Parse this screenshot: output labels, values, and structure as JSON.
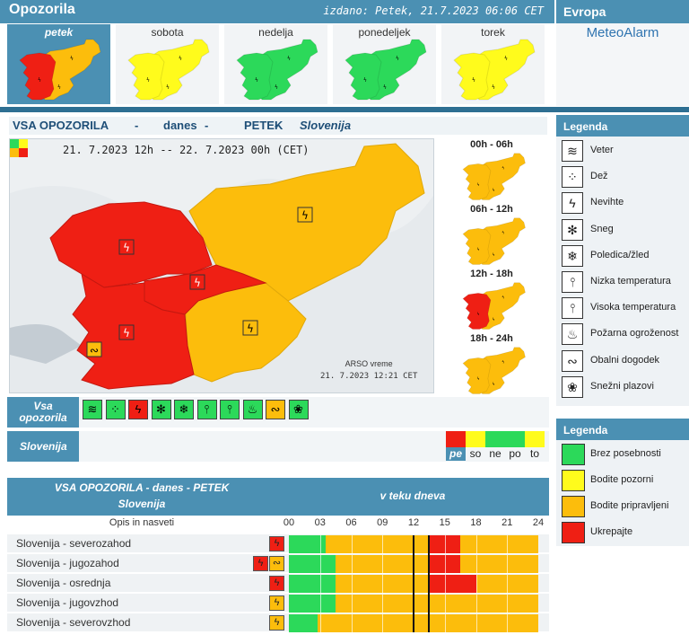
{
  "header": {
    "title": "Opozorila",
    "issued": "izdano: Petek, 21.7.2023 06:06 CET",
    "europe_title": "Evropa",
    "meteoalarm_link": "MeteoAlarm"
  },
  "days": [
    {
      "label": "petek",
      "active": true,
      "color": "#fcbd0c",
      "secondary_color": "#ef1f14"
    },
    {
      "label": "sobota",
      "active": false,
      "color": "#fffb1c"
    },
    {
      "label": "nedelja",
      "active": false,
      "color": "#2cd95a"
    },
    {
      "label": "ponedeljek",
      "active": false,
      "color": "#2cd95a"
    },
    {
      "label": "torek",
      "active": false,
      "color": "#fffb1c"
    }
  ],
  "main": {
    "title_parts": [
      "VSA OPOZORILA",
      "-",
      "danes",
      "-",
      "PETEK",
      "-",
      "Slovenija"
    ],
    "period": "21. 7.2023  12h  --  22. 7.2023  00h    (CET)",
    "credit_line1": "ARSO vreme",
    "credit_line2": "21. 7.2023  12:21 CET"
  },
  "mini_maps": [
    {
      "label": "00h - 06h",
      "colors": [
        "#fcbd0c",
        "#fcbd0c"
      ]
    },
    {
      "label": "06h - 12h",
      "colors": [
        "#fcbd0c",
        "#fcbd0c"
      ]
    },
    {
      "label": "12h - 18h",
      "colors": [
        "#fcbd0c",
        "#ef1f14"
      ]
    },
    {
      "label": "18h - 24h",
      "colors": [
        "#fcbd0c",
        "#fcbd0c"
      ]
    }
  ],
  "icon_row": {
    "label_line1": "Vsa",
    "label_line2": "opozorila",
    "icons": [
      {
        "name": "wind-icon",
        "glyph": "≋",
        "color": "#2cd95a"
      },
      {
        "name": "rain-icon",
        "glyph": "⁘",
        "color": "#2cd95a"
      },
      {
        "name": "thunderstorm-icon",
        "glyph": "ϟ",
        "color": "#ef1f14"
      },
      {
        "name": "snow-icon",
        "glyph": "✻",
        "color": "#2cd95a"
      },
      {
        "name": "ice-icon",
        "glyph": "❄",
        "color": "#2cd95a"
      },
      {
        "name": "low-temperature-icon",
        "glyph": "⫯",
        "color": "#2cd95a"
      },
      {
        "name": "high-temperature-icon",
        "glyph": "⫯",
        "color": "#2cd95a"
      },
      {
        "name": "fire-icon",
        "glyph": "♨",
        "color": "#2cd95a"
      },
      {
        "name": "coastal-icon",
        "glyph": "∾",
        "color": "#fcbd0c"
      },
      {
        "name": "avalanche-icon",
        "glyph": "❀",
        "color": "#2cd95a"
      }
    ]
  },
  "slovenija_row": {
    "label": "Slovenija",
    "days": [
      {
        "tag": "pe",
        "color": "#ef1f14",
        "active": true
      },
      {
        "tag": "so",
        "color": "#fffb1c",
        "active": false
      },
      {
        "tag": "ne",
        "color": "#2cd95a",
        "active": false
      },
      {
        "tag": "po",
        "color": "#2cd95a",
        "active": false
      },
      {
        "tag": "to",
        "color": "#fffb1c",
        "active": false
      }
    ]
  },
  "table": {
    "head_line1": "VSA OPOZORILA - danes - PETEK",
    "head_line2": "Slovenija",
    "head_right": "v teku dneva",
    "desc_label": "Opis in nasveti",
    "hours": [
      "00",
      "03",
      "06",
      "09",
      "12",
      "15",
      "18",
      "21",
      "24"
    ],
    "rows": [
      {
        "name": "Slovenija - severozahod",
        "icons": [
          {
            "glyph": "ϟ",
            "color": "#ef1f14"
          }
        ],
        "segments": [
          {
            "from": 0,
            "to": 3.5,
            "color": "#2cd95a"
          },
          {
            "from": 3.5,
            "to": 13.5,
            "color": "#fcbd0c"
          },
          {
            "from": 13.5,
            "to": 16.5,
            "color": "#ef1f14"
          },
          {
            "from": 16.5,
            "to": 24,
            "color": "#fcbd0c"
          }
        ]
      },
      {
        "name": "Slovenija - jugozahod",
        "icons": [
          {
            "glyph": "ϟ",
            "color": "#ef1f14"
          },
          {
            "glyph": "∾",
            "color": "#fcbd0c"
          }
        ],
        "segments": [
          {
            "from": 0,
            "to": 4.5,
            "color": "#2cd95a"
          },
          {
            "from": 4.5,
            "to": 13.5,
            "color": "#fcbd0c"
          },
          {
            "from": 13.5,
            "to": 16.5,
            "color": "#ef1f14"
          },
          {
            "from": 16.5,
            "to": 24,
            "color": "#fcbd0c"
          }
        ]
      },
      {
        "name": "Slovenija - osrednja",
        "icons": [
          {
            "glyph": "ϟ",
            "color": "#ef1f14"
          }
        ],
        "segments": [
          {
            "from": 0,
            "to": 4.5,
            "color": "#2cd95a"
          },
          {
            "from": 4.5,
            "to": 13.5,
            "color": "#fcbd0c"
          },
          {
            "from": 13.5,
            "to": 18,
            "color": "#ef1f14"
          },
          {
            "from": 18,
            "to": 24,
            "color": "#fcbd0c"
          }
        ]
      },
      {
        "name": "Slovenija - jugovzhod",
        "icons": [
          {
            "glyph": "ϟ",
            "color": "#fcbd0c"
          }
        ],
        "segments": [
          {
            "from": 0,
            "to": 4.5,
            "color": "#2cd95a"
          },
          {
            "from": 4.5,
            "to": 24,
            "color": "#fcbd0c"
          }
        ]
      },
      {
        "name": "Slovenija - severovzhod",
        "icons": [
          {
            "glyph": "ϟ",
            "color": "#fcbd0c"
          }
        ],
        "segments": [
          {
            "from": 0,
            "to": 2.8,
            "color": "#2cd95a"
          },
          {
            "from": 2.8,
            "to": 24,
            "color": "#fcbd0c"
          }
        ]
      }
    ],
    "markers": [
      12,
      13.5
    ]
  },
  "legend1": {
    "title": "Legenda",
    "items": [
      {
        "name": "wind-icon",
        "glyph": "≋",
        "label": "Veter"
      },
      {
        "name": "rain-icon",
        "glyph": "⁘",
        "label": "Dež"
      },
      {
        "name": "thunderstorm-icon",
        "glyph": "ϟ",
        "label": "Nevihte"
      },
      {
        "name": "snow-icon",
        "glyph": "✻",
        "label": "Sneg"
      },
      {
        "name": "ice-icon",
        "glyph": "❄",
        "label": "Poledica/žled"
      },
      {
        "name": "low-temperature-icon",
        "glyph": "⫯",
        "label": "Nizka temperatura"
      },
      {
        "name": "high-temperature-icon",
        "glyph": "⫯",
        "label": "Visoka temperatura"
      },
      {
        "name": "fire-icon",
        "glyph": "♨",
        "label": "Požarna ogroženost"
      },
      {
        "name": "coastal-icon",
        "glyph": "∾",
        "label": "Obalni dogodek"
      },
      {
        "name": "avalanche-icon",
        "glyph": "❀",
        "label": "Snežni plazovi"
      }
    ]
  },
  "legend2": {
    "title": "Legenda",
    "items": [
      {
        "label": "Brez posebnosti",
        "color": "#2cd95a"
      },
      {
        "label": "Bodite pozorni",
        "color": "#fffb1c"
      },
      {
        "label": "Bodite pripravljeni",
        "color": "#fcbd0c"
      },
      {
        "label": "Ukrepajte",
        "color": "#ef1f14"
      }
    ]
  }
}
